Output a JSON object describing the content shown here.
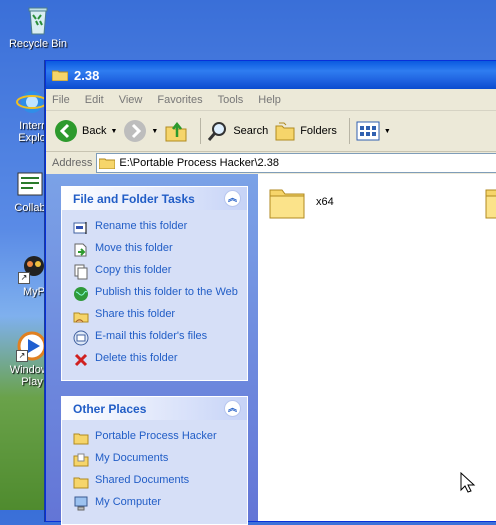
{
  "desktop": {
    "icons": [
      {
        "label": "Recycle Bin",
        "icon": "recycle-bin-icon"
      },
      {
        "label": "Interr\nExplo",
        "icon": "internet-explorer-icon"
      },
      {
        "label": "Collab",
        "icon": "collab-icon"
      },
      {
        "label": "MyP",
        "icon": "myp-icon"
      },
      {
        "label": "Windows\nPlay",
        "icon": "media-player-icon"
      }
    ]
  },
  "window": {
    "title": "2.38",
    "menu": [
      "File",
      "Edit",
      "View",
      "Favorites",
      "Tools",
      "Help"
    ],
    "toolbar": {
      "back": "Back",
      "search": "Search",
      "folders": "Folders"
    },
    "address": {
      "label": "Address",
      "value": "E:\\Portable Process Hacker\\2.38"
    },
    "tasks_panel": {
      "title": "File and Folder Tasks",
      "items": [
        {
          "label": "Rename this folder",
          "icon": "rename-icon"
        },
        {
          "label": "Move this folder",
          "icon": "move-icon"
        },
        {
          "label": "Copy this folder",
          "icon": "copy-icon"
        },
        {
          "label": "Publish this folder to the Web",
          "icon": "publish-web-icon"
        },
        {
          "label": "Share this folder",
          "icon": "share-icon"
        },
        {
          "label": "E-mail this folder's files",
          "icon": "email-icon"
        },
        {
          "label": "Delete this folder",
          "icon": "delete-icon"
        }
      ]
    },
    "places_panel": {
      "title": "Other Places",
      "items": [
        {
          "label": "Portable Process Hacker",
          "icon": "folder-icon"
        },
        {
          "label": "My Documents",
          "icon": "my-documents-icon"
        },
        {
          "label": "Shared Documents",
          "icon": "folder-icon"
        },
        {
          "label": "My Computer",
          "icon": "my-computer-icon"
        }
      ]
    },
    "files": [
      {
        "name": "x64",
        "icon": "folder-icon"
      },
      {
        "name": "",
        "icon": "folder-icon"
      }
    ]
  },
  "colors": {
    "link": "#215dc6",
    "titlebar": "#0a5ae0",
    "chrome": "#ece9d8"
  }
}
